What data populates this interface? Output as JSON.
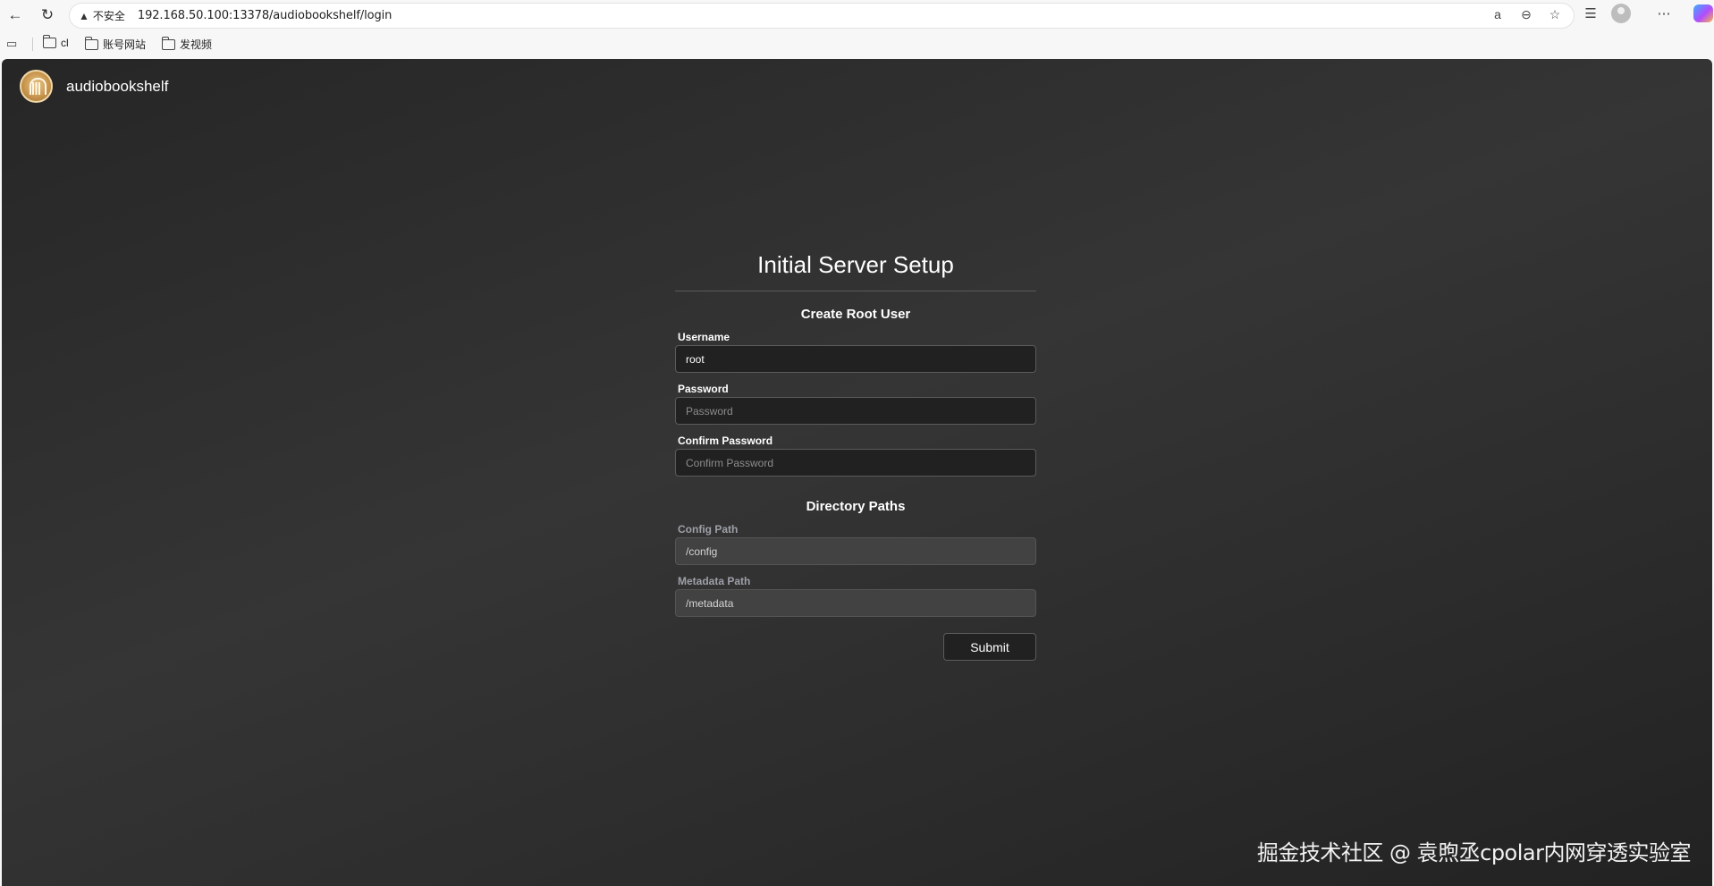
{
  "browser": {
    "insecure_label": "不安全",
    "url": "192.168.50.100:13378/audiobookshelf/login",
    "bookmarks": [
      {
        "label": "cl"
      },
      {
        "label": "账号网站"
      },
      {
        "label": "发视频"
      }
    ]
  },
  "app": {
    "title": "audiobookshelf"
  },
  "setup": {
    "title": "Initial Server Setup",
    "root_user": {
      "heading": "Create Root User",
      "username_label": "Username",
      "username_value": "root",
      "password_label": "Password",
      "password_placeholder": "Password",
      "confirm_label": "Confirm Password",
      "confirm_placeholder": "Confirm Password"
    },
    "directories": {
      "heading": "Directory Paths",
      "config_label": "Config Path",
      "config_value": "/config",
      "metadata_label": "Metadata Path",
      "metadata_value": "/metadata"
    },
    "submit_label": "Submit"
  },
  "watermark": "掘金技术社区 @ 袁煦丞cpolar内网穿透实验室"
}
